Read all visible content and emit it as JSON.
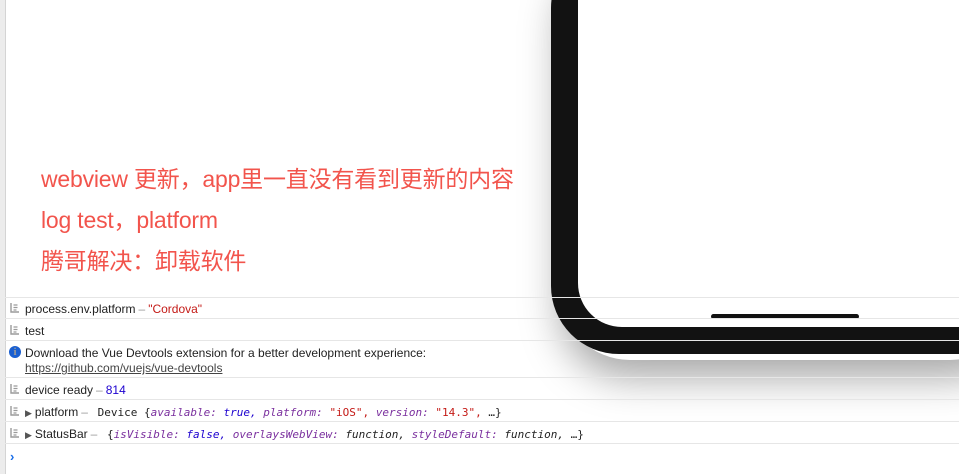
{
  "annotations": {
    "line1": "webview 更新，app里一直没有看到更新的内容",
    "line2": "log test，platform",
    "line3": "腾哥解决：卸载软件"
  },
  "console": {
    "row1": {
      "label": "process.env.platform",
      "sep": "–",
      "value": "\"Cordova\""
    },
    "row2": {
      "text": "test"
    },
    "row3": {
      "text": "Download the Vue Devtools extension for a better development experience:",
      "link": "https://github.com/vuejs/vue-devtools"
    },
    "row4": {
      "label": "device ready",
      "sep": "–",
      "value": "814"
    },
    "row5": {
      "label": "platform",
      "sep": "–",
      "type": "Device",
      "open": "{",
      "k1": "available:",
      "v1": "true,",
      "k2": "platform:",
      "v2": "\"iOS\",",
      "k3": "version:",
      "v3": "\"14.3\",",
      "more": "…}"
    },
    "row6": {
      "label": "StatusBar",
      "sep": "–",
      "open": "{",
      "k1": "isVisible:",
      "v1": "false,",
      "k2": "overlaysWebView:",
      "v2": "function,",
      "k3": "styleDefault:",
      "v3": "function,",
      "more": "…}"
    },
    "prompt": "›"
  },
  "colors": {
    "annotation": "#f2544c",
    "string": "#c41a16",
    "number": "#1c00cf",
    "info": "#1a5fd0"
  }
}
